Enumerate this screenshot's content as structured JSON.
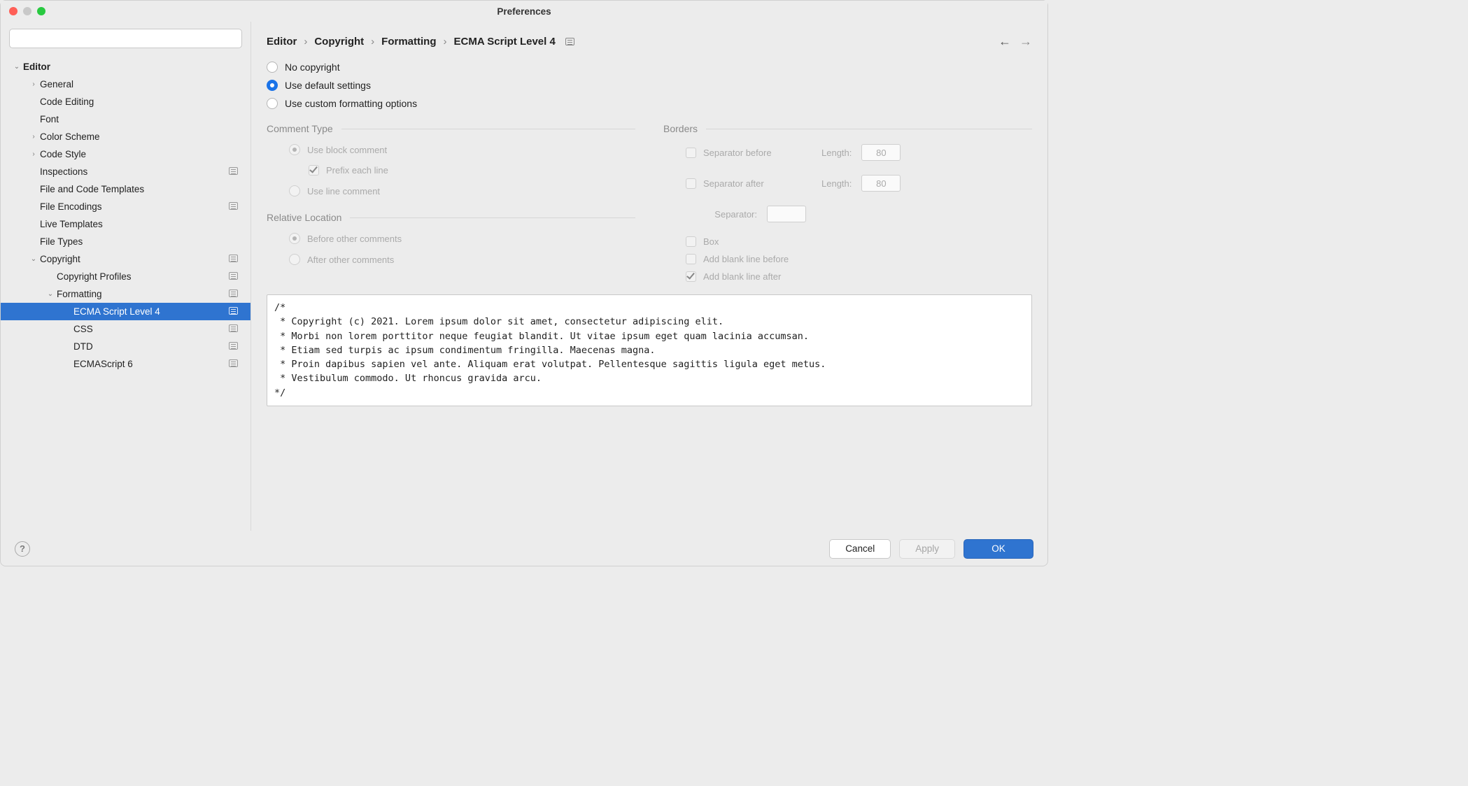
{
  "window": {
    "title": "Preferences"
  },
  "search": {
    "placeholder": ""
  },
  "tree": {
    "root": {
      "label": "Editor",
      "expanded": true
    },
    "items": [
      {
        "label": "General",
        "depth": 1,
        "arrow": "right",
        "badge": false
      },
      {
        "label": "Code Editing",
        "depth": 1,
        "arrow": "",
        "badge": false
      },
      {
        "label": "Font",
        "depth": 1,
        "arrow": "",
        "badge": false
      },
      {
        "label": "Color Scheme",
        "depth": 1,
        "arrow": "right",
        "badge": false
      },
      {
        "label": "Code Style",
        "depth": 1,
        "arrow": "right",
        "badge": false
      },
      {
        "label": "Inspections",
        "depth": 1,
        "arrow": "",
        "badge": true
      },
      {
        "label": "File and Code Templates",
        "depth": 1,
        "arrow": "",
        "badge": false
      },
      {
        "label": "File Encodings",
        "depth": 1,
        "arrow": "",
        "badge": true
      },
      {
        "label": "Live Templates",
        "depth": 1,
        "arrow": "",
        "badge": false
      },
      {
        "label": "File Types",
        "depth": 1,
        "arrow": "",
        "badge": false
      },
      {
        "label": "Copyright",
        "depth": 1,
        "arrow": "down",
        "badge": true
      },
      {
        "label": "Copyright Profiles",
        "depth": 2,
        "arrow": "",
        "badge": true
      },
      {
        "label": "Formatting",
        "depth": 2,
        "arrow": "down",
        "badge": true
      },
      {
        "label": "ECMA Script Level 4",
        "depth": 3,
        "arrow": "",
        "badge": true,
        "selected": true
      },
      {
        "label": "CSS",
        "depth": 3,
        "arrow": "",
        "badge": true
      },
      {
        "label": "DTD",
        "depth": 3,
        "arrow": "",
        "badge": true
      },
      {
        "label": "ECMAScript 6",
        "depth": 3,
        "arrow": "",
        "badge": true
      }
    ]
  },
  "breadcrumb": {
    "parts": [
      "Editor",
      "Copyright",
      "Formatting",
      "ECMA Script Level 4"
    ]
  },
  "mode": {
    "no_copyright": "No copyright",
    "use_default": "Use default settings",
    "use_custom": "Use custom formatting options",
    "selected": "use_default"
  },
  "comment_type": {
    "title": "Comment Type",
    "block": "Use block comment",
    "prefix": "Prefix each line",
    "line": "Use line comment"
  },
  "relative_location": {
    "title": "Relative Location",
    "before": "Before other comments",
    "after": "After other comments"
  },
  "borders": {
    "title": "Borders",
    "sep_before": "Separator before",
    "sep_after": "Separator after",
    "length_label": "Length:",
    "length_before": "80",
    "length_after": "80",
    "separator_label": "Separator:",
    "separator_value": "",
    "box": "Box",
    "blank_before": "Add blank line before",
    "blank_after": "Add blank line after"
  },
  "preview": "/*\n * Copyright (c) 2021. Lorem ipsum dolor sit amet, consectetur adipiscing elit.\n * Morbi non lorem porttitor neque feugiat blandit. Ut vitae ipsum eget quam lacinia accumsan.\n * Etiam sed turpis ac ipsum condimentum fringilla. Maecenas magna.\n * Proin dapibus sapien vel ante. Aliquam erat volutpat. Pellentesque sagittis ligula eget metus.\n * Vestibulum commodo. Ut rhoncus gravida arcu.\n*/",
  "footer": {
    "cancel": "Cancel",
    "apply": "Apply",
    "ok": "OK"
  }
}
